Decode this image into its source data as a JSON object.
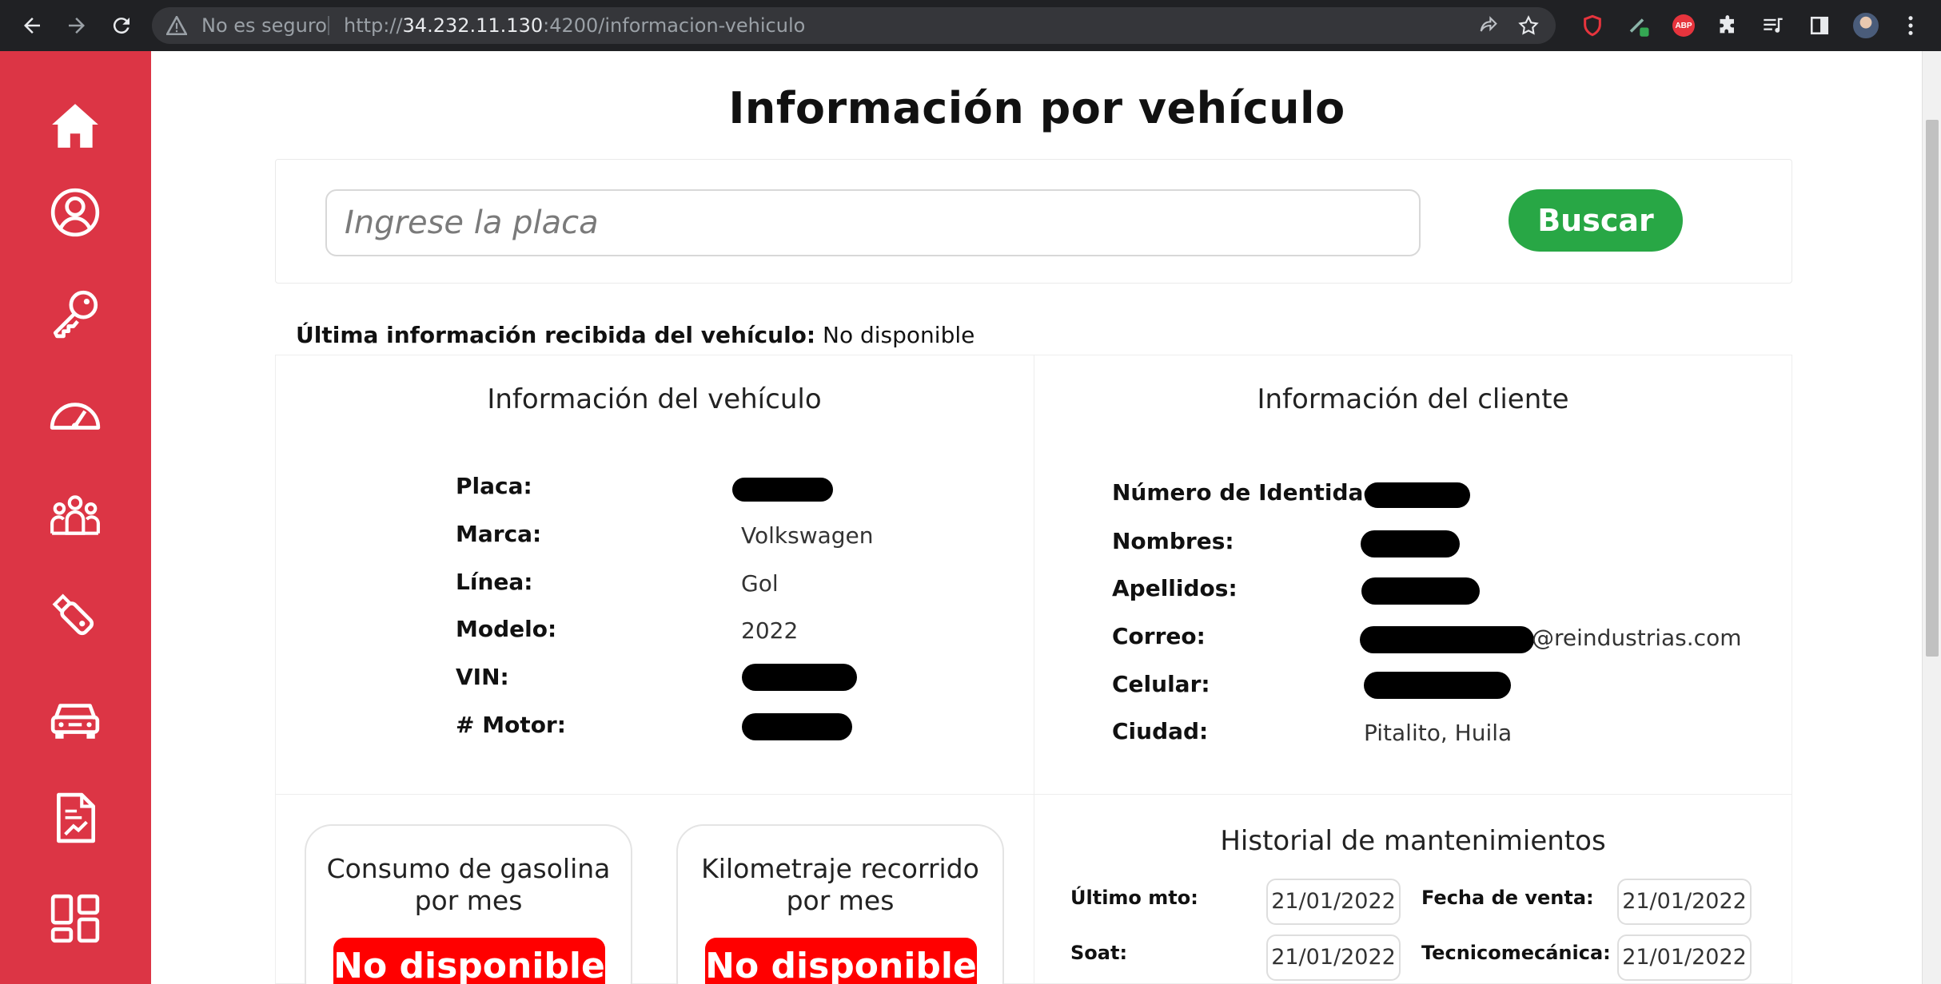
{
  "browser": {
    "security_label": "No es seguro",
    "url_prefix": "http://",
    "url_host": "34.232.11.130",
    "url_rest": ":4200/informacion-vehiculo",
    "abp_label": "ABP"
  },
  "sidebar": {
    "items": [
      {
        "icon": "home-icon"
      },
      {
        "icon": "user-icon"
      },
      {
        "icon": "key-icon"
      },
      {
        "icon": "speedometer-icon"
      },
      {
        "icon": "people-icon"
      },
      {
        "icon": "usb-icon"
      },
      {
        "icon": "car-icon"
      },
      {
        "icon": "report-icon"
      },
      {
        "icon": "dashboard-icon"
      }
    ],
    "color": "#dc3545"
  },
  "page": {
    "title": "Información por vehículo",
    "search_placeholder": "Ingrese la placa",
    "search_button": "Buscar",
    "last_info_label": "Última información recibida del vehículo:",
    "last_info_value": "No disponible"
  },
  "vehicle": {
    "title": "Información del vehículo",
    "rows": [
      {
        "label": "Placa:",
        "value": ""
      },
      {
        "label": "Marca:",
        "value": "Volkswagen"
      },
      {
        "label": "Línea:",
        "value": "Gol"
      },
      {
        "label": "Modelo:",
        "value": "2022"
      },
      {
        "label": "VIN:",
        "value": ""
      },
      {
        "label": "# Motor:",
        "value": ""
      }
    ]
  },
  "client": {
    "title": "Información del cliente",
    "rows": [
      {
        "label": "Número de Identidad:",
        "value": ""
      },
      {
        "label": "Nombres:",
        "value": ""
      },
      {
        "label": "Apellidos:",
        "value": ""
      },
      {
        "label": "Correo:",
        "value": "@reindustrias.com"
      },
      {
        "label": "Celular:",
        "value": ""
      },
      {
        "label": "Ciudad:",
        "value": "Pitalito, Huila"
      }
    ]
  },
  "metrics": [
    {
      "title_line1": "Consumo de gasolina",
      "title_line2": "por mes",
      "status": "No disponible"
    },
    {
      "title_line1": "Kilometraje recorrido",
      "title_line2": "por mes",
      "status": "No disponible"
    }
  ],
  "maintenance": {
    "title": "Historial de mantenimientos",
    "ultimo_mto_label": "Último mto:",
    "ultimo_mto_value": "21/01/2022",
    "fecha_venta_label": "Fecha de venta:",
    "fecha_venta_value": "21/01/2022",
    "soat_label": "Soat:",
    "soat_value": "21/01/2022",
    "tecnomecanica_label": "Tecnicomecánica:",
    "tecnomecanica_value": "21/01/2022"
  },
  "colors": {
    "accent_red": "#dc3545",
    "button_green": "#28a745",
    "badge_red": "#ff0000"
  }
}
